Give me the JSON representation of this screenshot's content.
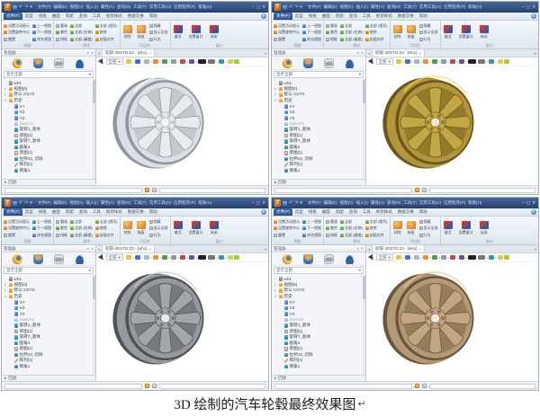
{
  "caption": {
    "text": "3D 绘制的汽车轮毂最终效果图",
    "mark": "↵"
  },
  "window": {
    "logo": "7",
    "quick": {
      "drop": "▾",
      "undo": "↶",
      "redo": "↷"
    },
    "menus": [
      "文件(F)",
      "编辑(E)",
      "视图(V)",
      "插入(I)",
      "属性(A)",
      "查询(N)",
      "工具(T)",
      "实用工具(U)",
      "应用程序(P)",
      "帮助(H)"
    ],
    "controls": {
      "min": "─",
      "max": "▢",
      "close": "✕"
    },
    "tabs": [
      "文件(F)",
      "造型",
      "线框",
      "曲面",
      "装配",
      "查询",
      "工具",
      "视觉样式",
      "数据交换",
      "帮助"
    ],
    "help": "?",
    "ribbon": {
      "g1": {
        "label": "视图",
        "colA": [
          "设置活动图元",
          "设置旋转中心",
          "重置"
        ],
        "colB": [
          "上一视图",
          "下一视图",
          "命名视图"
        ]
      },
      "g2": {
        "label": "操作",
        "colA": [
          "重画",
          "着色",
          "线框"
        ],
        "colB": [
          "全部",
          "全部 (拉伸)",
          "全部 (精度)"
        ],
        "colC": [
          "全部 (相切)",
          "修剪",
          "剖面对齐"
        ]
      },
      "g3": {
        "label": "可见性",
        "big": [
          "拭除",
          "恢复"
        ],
        "small": [
          "隐藏",
          "显示全部",
          "行为"
        ]
      },
      "g4": {
        "label": "窗口",
        "big": [
          "激活",
          "设置窗口",
          "关闭"
        ]
      }
    },
    "manager": {
      "title": "管理器",
      "pin": "▾",
      "close": "✕",
      "filter": "显示全部",
      "filter_drop": "▾",
      "tree": [
        {
          "icon": "user",
          "exp": "",
          "label": "wh1"
        },
        {
          "icon": "folder",
          "exp": "▸",
          "label": "视图(6)"
        },
        {
          "icon": "folder",
          "exp": "▸",
          "label": "默认 CSYS"
        },
        {
          "icon": "folder",
          "exp": "▾",
          "label": "历史"
        },
        {
          "icon": "plane",
          "exp": "",
          "label": "XY"
        },
        {
          "icon": "plane",
          "exp": "",
          "label": "XZ"
        },
        {
          "icon": "plane",
          "exp": "",
          "label": "YZ"
        },
        {
          "icon": "sketchg",
          "exp": "",
          "label": "Sketch1",
          "gray": true
        },
        {
          "icon": "feat",
          "exp": "",
          "label": "旋转1_基体"
        },
        {
          "icon": "sketch",
          "exp": "",
          "label": "草图(1)"
        },
        {
          "icon": "feat",
          "exp": "",
          "label": "旋转7_基体"
        },
        {
          "icon": "feat",
          "exp": "",
          "label": "圆角4"
        },
        {
          "icon": "sketch",
          "exp": "",
          "label": "草图(1)"
        },
        {
          "icon": "feat",
          "exp": "",
          "label": "拉伸13_切除"
        },
        {
          "icon": "line",
          "exp": "",
          "label": "阵列(1)"
        },
        {
          "icon": "feat",
          "exp": "",
          "label": "倒角1"
        }
      ],
      "replay": {
        "exp": "▸",
        "label": "回放"
      }
    },
    "doc": {
      "nav": "◂",
      "tab": "轮毂-3DSTD.Z3 - [wh1]",
      "close": "×",
      "more": "▾"
    },
    "da": {
      "select": "全部",
      "drop": "▾",
      "chips": [
        "#e7c53c",
        "#3f74c8",
        "#aeb4bd",
        "#e8912e",
        "#49a04d",
        "#8d98a8",
        "#c2483f",
        "#6a51a8",
        "#222222",
        "#777777",
        "#2e9aa8",
        "#d8d24a",
        "#9ccf3e"
      ]
    }
  },
  "quadrants": [
    {
      "name": "wheel-silver",
      "material": "silver",
      "wheel": {
        "edge": "#8f959e",
        "rim": "#dcdfe4",
        "face": "#c3c8cf",
        "spoke": "#e9ebef",
        "hole": "#f8f9fa",
        "hi": "#ffffff"
      }
    },
    {
      "name": "wheel-gold",
      "material": "gold",
      "wheel": {
        "edge": "#6a561c",
        "rim": "#b1963a",
        "face": "#937b2b",
        "spoke": "#c2a744",
        "hole": "#efe8d2",
        "hi": "#eedd66"
      }
    },
    {
      "name": "wheel-steel",
      "material": "steel-gray",
      "wheel": {
        "edge": "#4f5154",
        "rim": "#96999e",
        "face": "#77797e",
        "spoke": "#a3a6ab",
        "hole": "#e8e9eb",
        "hi": "#c9ccd1"
      }
    },
    {
      "name": "wheel-bronze",
      "material": "bronze",
      "wheel": {
        "edge": "#6b543c",
        "rim": "#b39a75",
        "face": "#977c5c",
        "spoke": "#c1a681",
        "hole": "#efe7db",
        "hi": "#e0cba6"
      }
    }
  ]
}
